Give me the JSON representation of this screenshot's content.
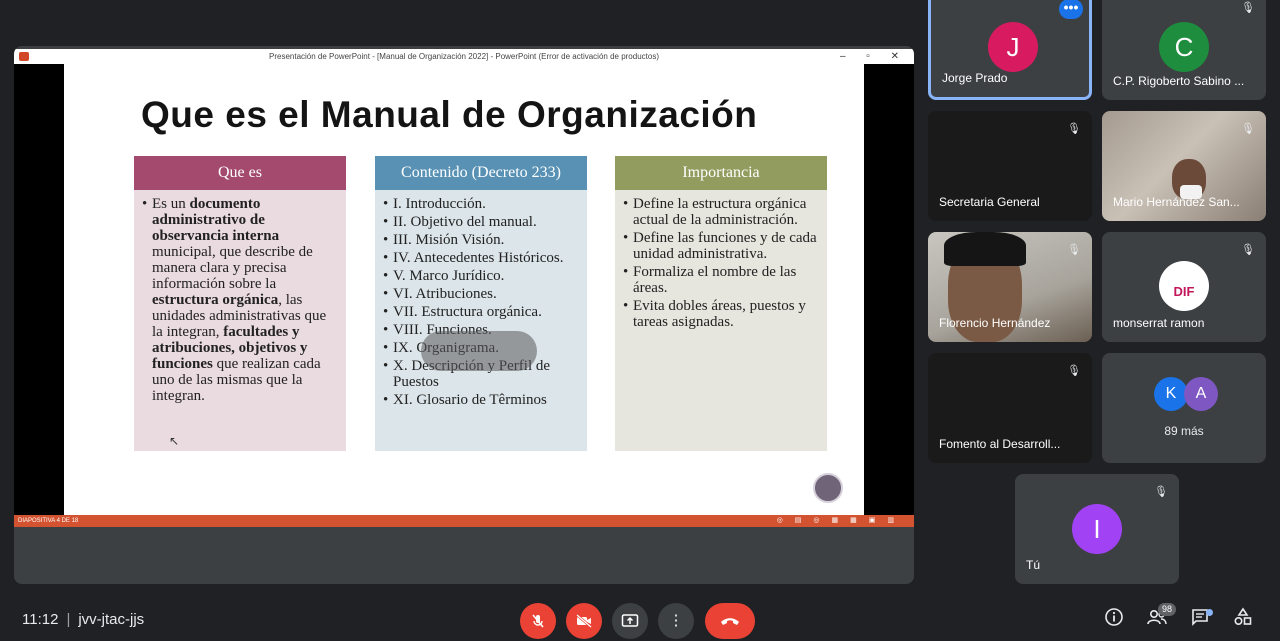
{
  "presentation": {
    "window_title": "Presentación de PowerPoint - [Manual de Organización 2022] - PowerPoint (Error de activación de productos)",
    "window_controls": "– ▫ ✕",
    "slide_title": "Que es el Manual de Organización",
    "status_text": "DIAPOSITIVA 4 DE 18",
    "columns": [
      {
        "header": "Que es",
        "color": "#a34a6e",
        "body_parts": [
          {
            "text": "Es un ",
            "bold": false
          },
          {
            "text": "documento administrativo de observancia interna",
            "bold": true
          },
          {
            "text": " municipal, que describe de manera clara y precisa información sobre la ",
            "bold": false
          },
          {
            "text": "estructura orgánica",
            "bold": true
          },
          {
            "text": ", las unidades administrativas que la integran, ",
            "bold": false
          },
          {
            "text": "facultades y atribuciones, objetivos y funciones",
            "bold": true
          },
          {
            "text": " que realizan cada uno de las mismas que la integran.",
            "bold": false
          }
        ]
      },
      {
        "header": "Contenido (Decreto 233)",
        "color": "#5891b3",
        "items": [
          "I. Introducción.",
          "II. Objetivo del manual.",
          "III. Misión Visión.",
          "IV. Antecedentes Históricos.",
          "V. Marco Jurídico.",
          "VI. Atribuciones.",
          "VII. Estructura orgánica.",
          "VIII. Funciones.",
          "IX. Organigrama.",
          "X. Descripción y Perfil de Puestos",
          "XI. Glosario de Têrminos"
        ]
      },
      {
        "header": "Importancia",
        "color": "#939c5f",
        "items": [
          "Define la estructura orgánica actual de la administración.",
          "Define las funciones y de cada unidad administrativa.",
          "Formaliza el nombre de las áreas.",
          "Evita dobles áreas, puestos y tareas asignadas."
        ]
      }
    ]
  },
  "participants": [
    {
      "name": "Jorge Prado",
      "initial": "J",
      "avatar_color": "#d81b60",
      "active": true
    },
    {
      "name": "C.P. Rigoberto Sabino ...",
      "initial": "C",
      "avatar_color": "#1e8e3e",
      "muted": true
    },
    {
      "name": "Secretaria General",
      "muted": true
    },
    {
      "name": "Mario Hernández San...",
      "muted": true
    },
    {
      "name": "Florencio Hernández",
      "muted": true
    },
    {
      "name": "monserrat ramon",
      "logo_text": "DIF",
      "muted": true
    },
    {
      "name": "Fomento al Desarroll...",
      "muted": true
    },
    {
      "others_label": "89 más",
      "mini_avatars": [
        {
          "initial": "K",
          "color": "#1a73e8"
        },
        {
          "initial": "A",
          "color": "#7e57c2"
        }
      ]
    },
    {
      "name": "Tú",
      "initial": "I",
      "avatar_color": "#a142f4",
      "muted": true
    }
  ],
  "bottom_bar": {
    "time": "11:12",
    "separator": "|",
    "meeting_code": "jvv-jtac-jjs",
    "participant_count": "98",
    "controls": {
      "mic_icon": "mic-off-icon",
      "cam_icon": "camera-off-icon",
      "present_icon": "present-icon",
      "more_icon": "more-options-icon",
      "hangup_icon": "hangup-icon"
    }
  }
}
